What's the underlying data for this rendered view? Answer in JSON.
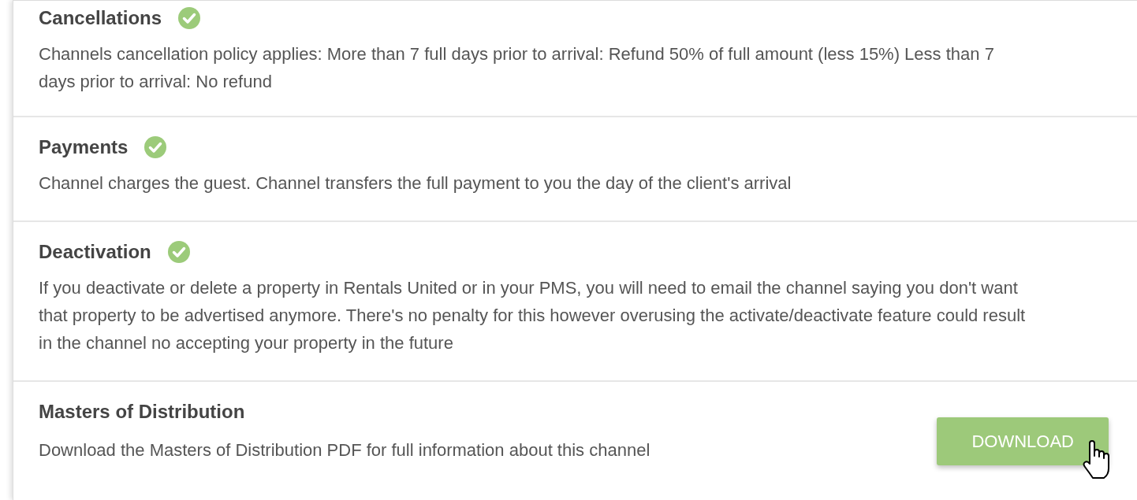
{
  "sections": [
    {
      "title": "Cancellations",
      "verified": true,
      "description": "Channels cancellation policy applies: More than 7 full days prior to arrival: Refund 50% of full amount (less 15%) Less than 7 days prior to arrival: No refund"
    },
    {
      "title": "Payments",
      "verified": true,
      "description": "Channel charges the guest. Channel transfers the full payment to you the day of the client's arrival"
    },
    {
      "title": "Deactivation",
      "verified": true,
      "description": "If you deactivate or delete a property in Rentals United or in your PMS, you will need to email the channel saying you don't want that property to be advertised anymore. There's no penalty for this however overusing the activate/deactivate feature could result in the channel no accepting your property in the future"
    },
    {
      "title": "Masters of Distribution",
      "verified": false,
      "description": "Download the Masters of Distribution PDF for full information about this channel",
      "button": "DOWNLOAD"
    }
  ]
}
